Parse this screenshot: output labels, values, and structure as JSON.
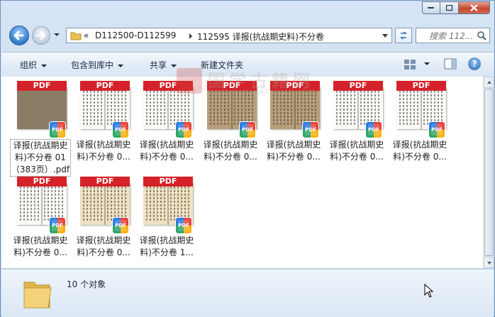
{
  "address": {
    "chevron": "«",
    "segments": [
      "D112500-D112599",
      "112595 译报(抗战期史料)不分卷"
    ]
  },
  "search": {
    "placeholder": "搜索 112..."
  },
  "toolbar": {
    "organize": "组织",
    "include_in_library": "包含到库中",
    "share": "共享",
    "new_folder": "新建文件夹"
  },
  "files": [
    {
      "name": "译报(抗战期史料)不分卷 01（383页）.pdf",
      "thumb": "dusky",
      "selected": true
    },
    {
      "name": "译报(抗战期史料)不分卷 0...",
      "thumb": "light"
    },
    {
      "name": "译报(抗战期史料)不分卷 0...",
      "thumb": "light"
    },
    {
      "name": "译报(抗战期史料)不分卷 0...",
      "thumb": "dark"
    },
    {
      "name": "译报(抗战期史料)不分卷 0...",
      "thumb": "dark"
    },
    {
      "name": "译报(抗战期史料)不分卷 0...",
      "thumb": "light"
    },
    {
      "name": "译报(抗战期史料)不分卷 0...",
      "thumb": "light"
    },
    {
      "name": "译报(抗战期史料)不分卷 0...",
      "thumb": "light"
    },
    {
      "name": "译报(抗战期史料)不分卷 0...",
      "thumb": "tan"
    },
    {
      "name": "译报(抗战期史料)不分卷 1...",
      "thumb": "tan"
    }
  ],
  "pdf_ribbon_label": "PDF",
  "watermark": {
    "cn": "国学古籍网",
    "en": "www.guoxuéziyuan.com"
  },
  "status": {
    "count": "10 个对象"
  },
  "colors": {
    "ribbon": "#d5222a",
    "accent": "#2f79c9"
  }
}
